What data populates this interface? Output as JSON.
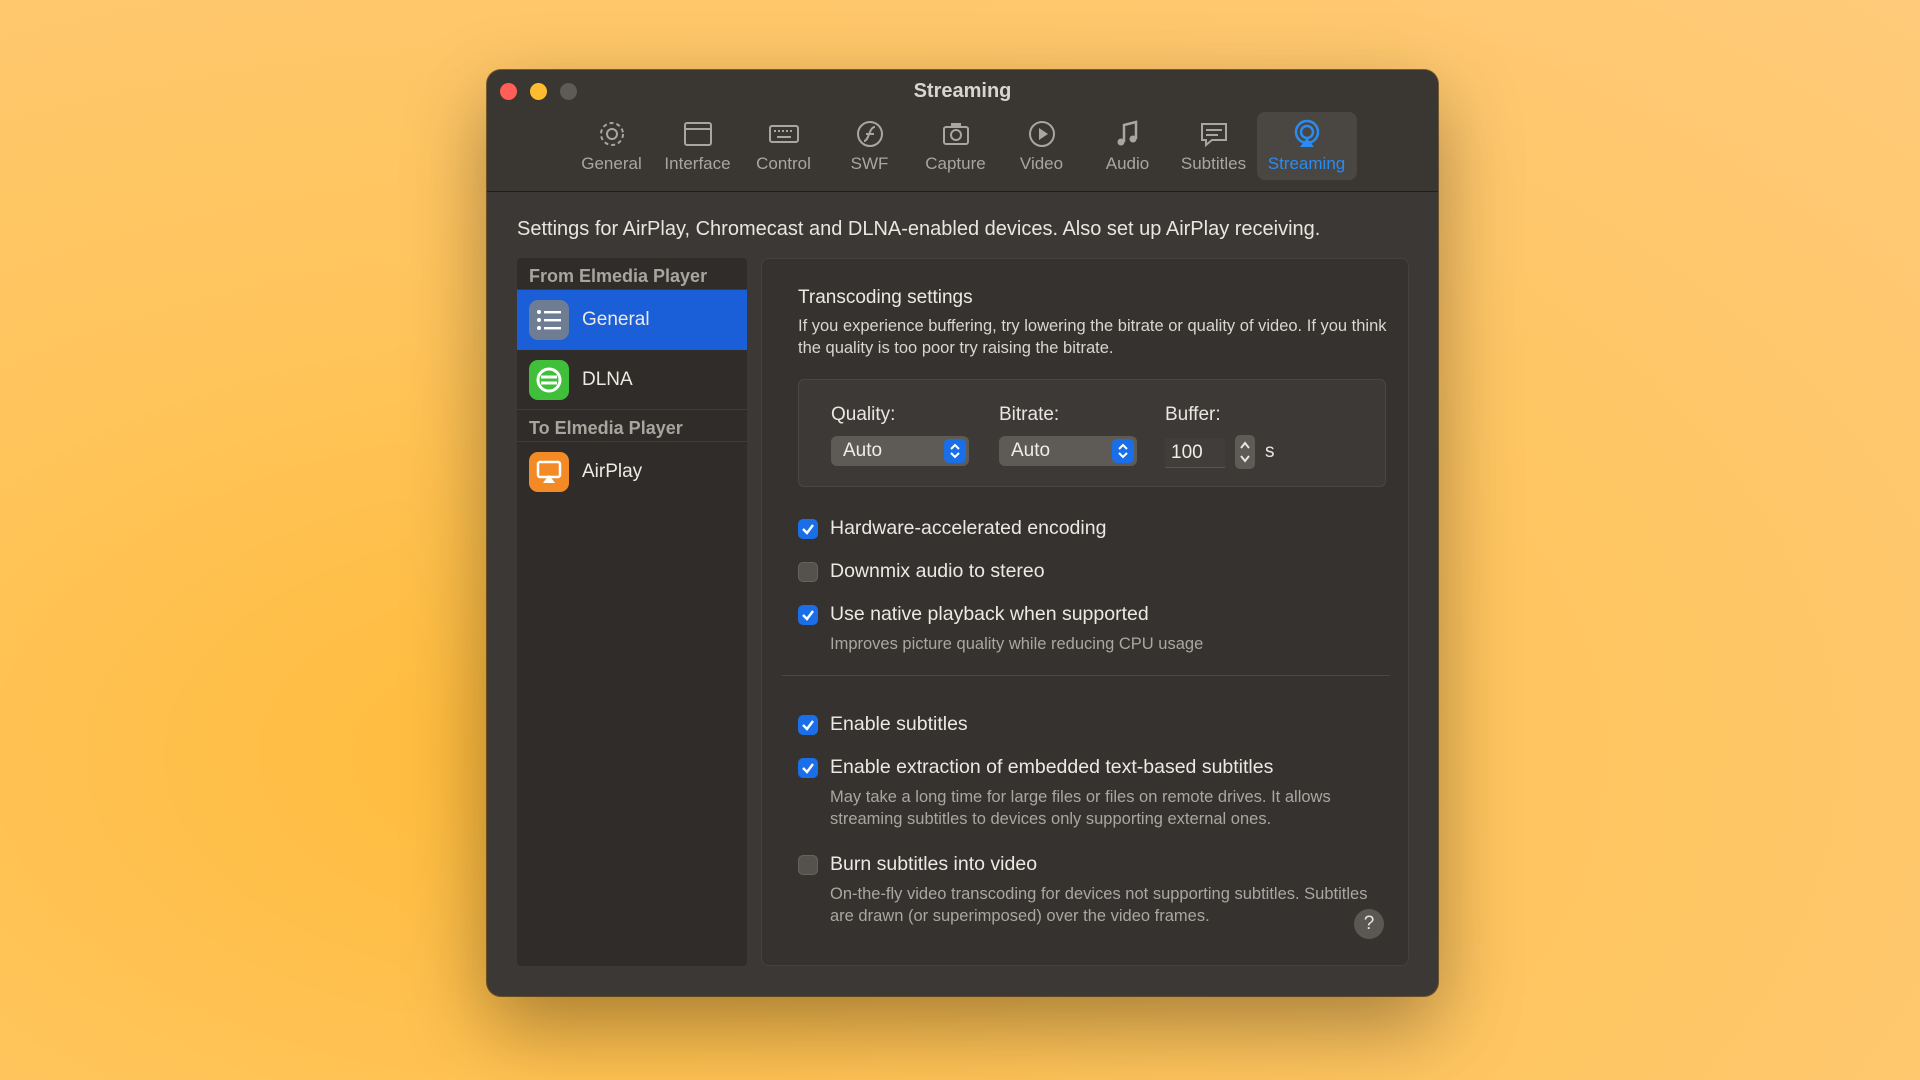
{
  "window": {
    "title": "Streaming"
  },
  "toolbar": {
    "items": [
      {
        "label": "General",
        "icon": "gear-icon"
      },
      {
        "label": "Interface",
        "icon": "window-icon"
      },
      {
        "label": "Control",
        "icon": "keyboard-icon"
      },
      {
        "label": "SWF",
        "icon": "flash-icon"
      },
      {
        "label": "Capture",
        "icon": "camera-icon"
      },
      {
        "label": "Video",
        "icon": "play-icon"
      },
      {
        "label": "Audio",
        "icon": "music-note-icon"
      },
      {
        "label": "Subtitles",
        "icon": "speech-bubble-icon"
      },
      {
        "label": "Streaming",
        "icon": "airplay-icon",
        "active": true
      }
    ]
  },
  "description": "Settings for AirPlay, Chromecast and DLNA-enabled devices. Also set up AirPlay receiving.",
  "sidebar": {
    "from_section": "From Elmedia Player",
    "from_items": [
      {
        "label": "General",
        "icon": "list-icon",
        "selected": true
      },
      {
        "label": "DLNA",
        "icon": "dlna-icon"
      }
    ],
    "to_section": "To Elmedia Player",
    "to_items": [
      {
        "label": "AirPlay",
        "icon": "airplay-icon"
      }
    ]
  },
  "panel": {
    "title": "Transcoding settings",
    "desc": "If you experience buffering, try lowering the bitrate or quality of video. If you think the quality is too poor try raising the bitrate.",
    "quality_label": "Quality:",
    "quality_value": "Auto",
    "bitrate_label": "Bitrate:",
    "bitrate_value": "Auto",
    "buffer_label": "Buffer:",
    "buffer_value": "100",
    "buffer_unit": "s",
    "options": {
      "hw": {
        "label": "Hardware-accelerated encoding",
        "checked": true
      },
      "downmix": {
        "label": "Downmix audio to stereo",
        "checked": false
      },
      "native": {
        "label": "Use native playback when supported",
        "checked": true,
        "note": "Improves picture quality while reducing CPU usage"
      },
      "subs": {
        "label": "Enable subtitles",
        "checked": true
      },
      "extract": {
        "label": "Enable extraction of embedded text-based subtitles",
        "checked": true,
        "note": "May take a long time for large files or files on remote drives. It allows streaming subtitles to devices only supporting external ones."
      },
      "burn": {
        "label": "Burn subtitles into video",
        "checked": false,
        "note": "On-the-fly video transcoding for devices not supporting subtitles. Subtitles are drawn (or superimposed) over the video frames."
      }
    },
    "help": "?"
  },
  "colors": {
    "accent": "#1a6ee8",
    "selected": "#1a5ed8",
    "active_tab": "#2a8cf2"
  }
}
